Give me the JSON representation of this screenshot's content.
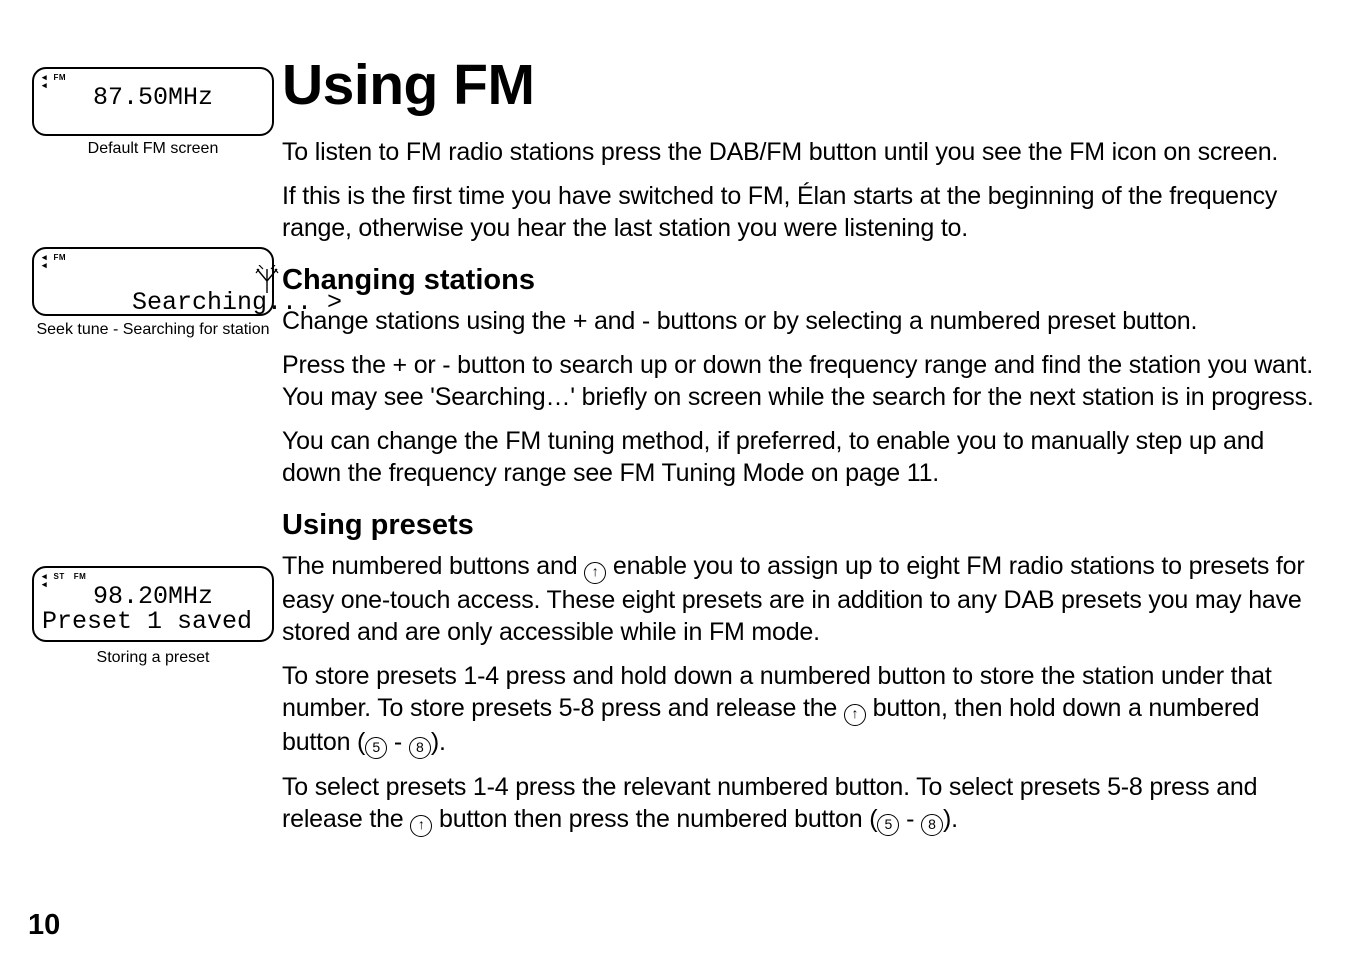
{
  "page_number": "10",
  "title": "Using FM",
  "intro_p1": "To listen to FM radio stations press the DAB/FM button until you see the FM icon on screen.",
  "intro_p2": "If this is the first time you have switched to FM, Élan starts at the beginning of the frequency range, otherwise you hear the last station you were listening to.",
  "section1_heading": "Changing stations",
  "section1_p1": "Change stations using the + and - buttons or by selecting a numbered preset button.",
  "section1_p2": "Press the + or - button to search up or down the frequency range and find the station you want. You may see 'Searching…' briefly on screen while the search for the next station is in progress.",
  "section1_p3": "You can change the FM tuning method, if preferred, to enable you to manually step up and down the frequency range see FM Tuning Mode on page 11.",
  "section2_heading": "Using presets",
  "section2_p1_a": "The numbered buttons and ",
  "section2_p1_b": " enable you to assign up to eight FM radio stations to presets for easy one-touch access. These eight presets are in addition to any DAB presets you may have stored and are only accessible while in FM mode.",
  "section2_p2_a": "To store presets 1-4 press and hold down a numbered button to store the station under that number. To store presets 5-8 press and release the ",
  "section2_p2_b": " button, then hold down a numbered button (",
  "section2_p2_c": " - ",
  "section2_p2_d": ").",
  "section2_p3_a": "To select presets 1-4 press the relevant numbered button. To select presets 5-8 press and release the ",
  "section2_p3_b": " button then press the numbered button  (",
  "section2_p3_c": " - ",
  "section2_p3_d": ").",
  "circled_up": "↑",
  "circled_5": "5",
  "circled_8": "8",
  "lcd1": {
    "icons_fm": "FM",
    "freq": "87.50MHz",
    "caption": "Default FM screen"
  },
  "lcd2": {
    "icons_fm": "FM",
    "text": "Searching... >",
    "caption": "Seek tune - Searching for station"
  },
  "lcd3": {
    "icons_st": "ST",
    "icons_fm": "FM",
    "freq": "98.20MHz",
    "preset": "Preset 1 saved",
    "caption": "Storing a preset"
  }
}
